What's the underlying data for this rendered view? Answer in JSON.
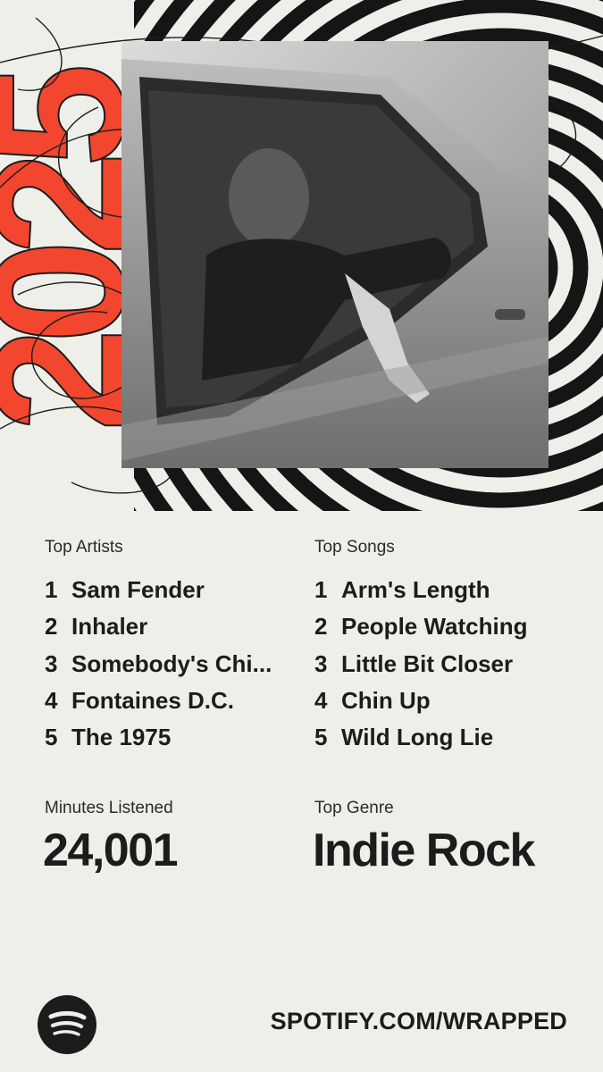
{
  "year": "2025",
  "colors": {
    "background": "#efefea",
    "accent": "#f2462e",
    "stripes": "#151515",
    "text": "#1c1c1c"
  },
  "top_artists": {
    "heading": "Top Artists",
    "items": [
      {
        "rank": "1",
        "name": "Sam Fender"
      },
      {
        "rank": "2",
        "name": "Inhaler"
      },
      {
        "rank": "3",
        "name": "Somebody's Chi..."
      },
      {
        "rank": "4",
        "name": "Fontaines D.C."
      },
      {
        "rank": "5",
        "name": "The 1975"
      }
    ]
  },
  "top_songs": {
    "heading": "Top Songs",
    "items": [
      {
        "rank": "1",
        "name": "Arm's Length"
      },
      {
        "rank": "2",
        "name": "People Watching"
      },
      {
        "rank": "3",
        "name": "Little Bit Closer"
      },
      {
        "rank": "4",
        "name": "Chin Up"
      },
      {
        "rank": "5",
        "name": "Wild Long Lie"
      }
    ]
  },
  "minutes": {
    "heading": "Minutes Listened",
    "value": "24,001"
  },
  "genre": {
    "heading": "Top Genre",
    "value": "Indie Rock"
  },
  "footer": {
    "logo_icon": "spotify-logo-icon",
    "url": "SPOTIFY.COM/WRAPPED"
  }
}
